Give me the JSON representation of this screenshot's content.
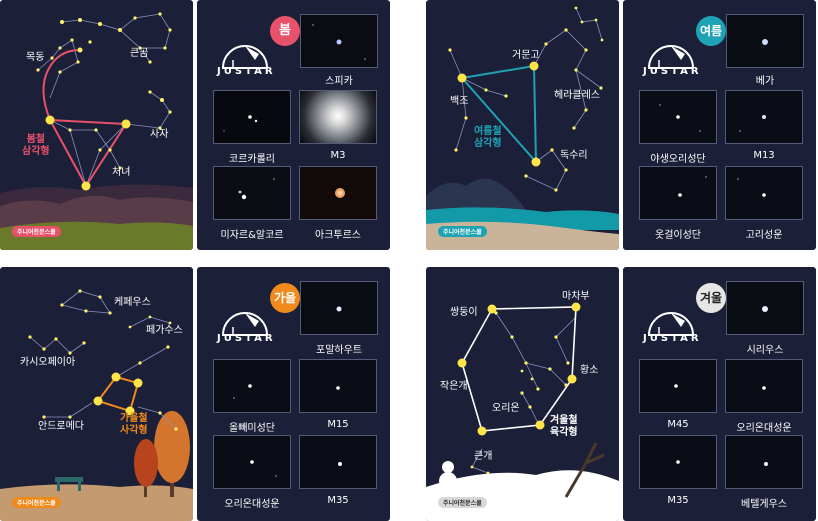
{
  "brand_label": "주니어천문스쿨",
  "logo_text": "JUSTAR",
  "spring": {
    "season": "봄",
    "triangle_label": [
      "봄철",
      "삼각형"
    ],
    "constellations": [
      "목동",
      "큰곰",
      "사자",
      "처녀"
    ],
    "objects": [
      "스피카",
      "코르카롤리",
      "M3",
      "미자르&알코르",
      "아크투르스"
    ]
  },
  "summer": {
    "season": "여름",
    "triangle_label": [
      "여름철",
      "삼각형"
    ],
    "constellations": [
      "거문고",
      "백조",
      "헤라클레스",
      "독수리"
    ],
    "objects": [
      "베가",
      "야생오리성단",
      "M13",
      "옷걸이성단",
      "고리성운"
    ]
  },
  "autumn": {
    "season": "가을",
    "triangle_label": [
      "가을철",
      "사각형"
    ],
    "constellations": [
      "케페우스",
      "페가수스",
      "카시오페이아",
      "안드로메다"
    ],
    "objects": [
      "포말하우트",
      "올빼미성단",
      "M15",
      "오리온대성운",
      "M35"
    ]
  },
  "winter": {
    "season": "겨울",
    "triangle_label": [
      "겨울철",
      "육각형"
    ],
    "constellations": [
      "마차부",
      "쌍둥이",
      "황소",
      "작은개",
      "오리온",
      "큰개"
    ],
    "objects": [
      "시리우스",
      "M45",
      "오리온대성운",
      "M35",
      "베텔게우스"
    ]
  },
  "colors": {
    "background": "#1c1f38",
    "spring": "#e8516a",
    "summer": "#1ea3b5",
    "autumn": "#f08a1c",
    "winter": "#e6e6e6"
  }
}
